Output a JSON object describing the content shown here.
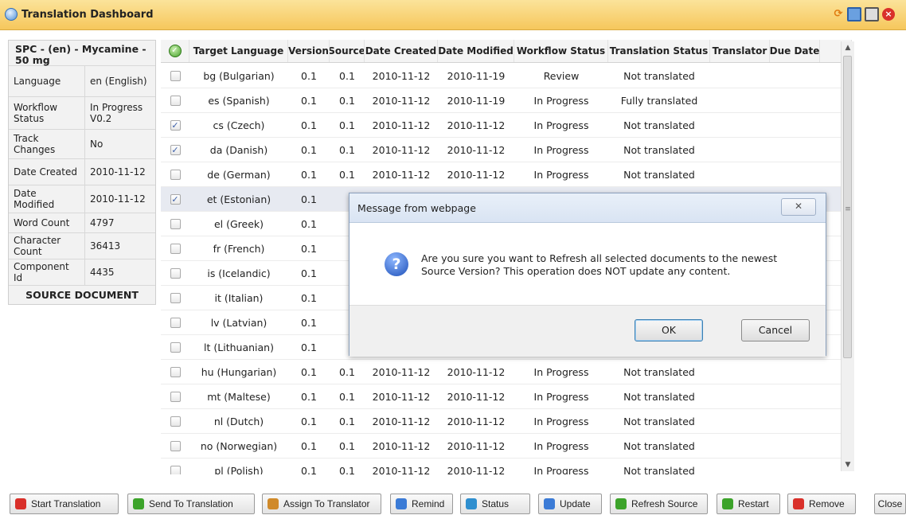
{
  "window": {
    "title": "Translation Dashboard"
  },
  "document": {
    "header": "SPC - (en) - Mycamine - 50 mg",
    "fields": [
      {
        "label": "Language",
        "value": "en (English)"
      },
      {
        "label": "Workflow Status",
        "value": "In Progress V0.2"
      },
      {
        "label": "Track Changes",
        "value": "No"
      },
      {
        "label": "Date Created",
        "value": "2010-11-12"
      },
      {
        "label": "Date Modified",
        "value": "2010-11-12"
      },
      {
        "label": "Word Count",
        "value": "4797"
      },
      {
        "label": "Character Count",
        "value": "36413"
      },
      {
        "label": "Component Id",
        "value": "4435"
      }
    ],
    "footer": "SOURCE DOCUMENT"
  },
  "grid": {
    "headers": [
      "Target Language",
      "Version",
      "Source",
      "Date Created",
      "Date Modified",
      "Workflow Status",
      "Translation Status",
      "Translator",
      "Due Date"
    ],
    "rows": [
      {
        "checked": false,
        "lang": "bg (Bulgarian)",
        "version": "0.1",
        "source": "0.1",
        "created": "2010-11-12",
        "modified": "2010-11-19",
        "workflow": "Review",
        "translation": "Not translated",
        "translator": "",
        "due": ""
      },
      {
        "checked": false,
        "lang": "es (Spanish)",
        "version": "0.1",
        "source": "0.1",
        "created": "2010-11-12",
        "modified": "2010-11-19",
        "workflow": "In Progress",
        "translation": "Fully translated",
        "translator": "",
        "due": ""
      },
      {
        "checked": true,
        "lang": "cs (Czech)",
        "version": "0.1",
        "source": "0.1",
        "created": "2010-11-12",
        "modified": "2010-11-12",
        "workflow": "In Progress",
        "translation": "Not translated",
        "translator": "",
        "due": ""
      },
      {
        "checked": true,
        "lang": "da (Danish)",
        "version": "0.1",
        "source": "0.1",
        "created": "2010-11-12",
        "modified": "2010-11-12",
        "workflow": "In Progress",
        "translation": "Not translated",
        "translator": "",
        "due": ""
      },
      {
        "checked": false,
        "lang": "de (German)",
        "version": "0.1",
        "source": "0.1",
        "created": "2010-11-12",
        "modified": "2010-11-12",
        "workflow": "In Progress",
        "translation": "Not translated",
        "translator": "",
        "due": ""
      },
      {
        "checked": true,
        "lang": "et (Estonian)",
        "version": "0.1",
        "source": "",
        "created": "",
        "modified": "",
        "workflow": "",
        "translation": "",
        "translator": "",
        "due": ""
      },
      {
        "checked": false,
        "lang": "el (Greek)",
        "version": "0.1",
        "source": "",
        "created": "",
        "modified": "",
        "workflow": "",
        "translation": "",
        "translator": "",
        "due": ""
      },
      {
        "checked": false,
        "lang": "fr (French)",
        "version": "0.1",
        "source": "",
        "created": "",
        "modified": "",
        "workflow": "",
        "translation": "",
        "translator": "",
        "due": ""
      },
      {
        "checked": false,
        "lang": "is (Icelandic)",
        "version": "0.1",
        "source": "",
        "created": "",
        "modified": "",
        "workflow": "",
        "translation": "",
        "translator": "",
        "due": ""
      },
      {
        "checked": false,
        "lang": "it (Italian)",
        "version": "0.1",
        "source": "",
        "created": "",
        "modified": "",
        "workflow": "",
        "translation": "",
        "translator": "",
        "due": ""
      },
      {
        "checked": false,
        "lang": "lv (Latvian)",
        "version": "0.1",
        "source": "",
        "created": "",
        "modified": "",
        "workflow": "",
        "translation": "",
        "translator": "",
        "due": ""
      },
      {
        "checked": false,
        "lang": "lt (Lithuanian)",
        "version": "0.1",
        "source": "",
        "created": "",
        "modified": "",
        "workflow": "",
        "translation": "",
        "translator": "",
        "due": ""
      },
      {
        "checked": false,
        "lang": "hu (Hungarian)",
        "version": "0.1",
        "source": "0.1",
        "created": "2010-11-12",
        "modified": "2010-11-12",
        "workflow": "In Progress",
        "translation": "Not translated",
        "translator": "",
        "due": ""
      },
      {
        "checked": false,
        "lang": "mt (Maltese)",
        "version": "0.1",
        "source": "0.1",
        "created": "2010-11-12",
        "modified": "2010-11-12",
        "workflow": "In Progress",
        "translation": "Not translated",
        "translator": "",
        "due": ""
      },
      {
        "checked": false,
        "lang": "nl (Dutch)",
        "version": "0.1",
        "source": "0.1",
        "created": "2010-11-12",
        "modified": "2010-11-12",
        "workflow": "In Progress",
        "translation": "Not translated",
        "translator": "",
        "due": ""
      },
      {
        "checked": false,
        "lang": "no (Norwegian)",
        "version": "0.1",
        "source": "0.1",
        "created": "2010-11-12",
        "modified": "2010-11-12",
        "workflow": "In Progress",
        "translation": "Not translated",
        "translator": "",
        "due": ""
      },
      {
        "checked": false,
        "lang": "pl (Polish)",
        "version": "0.1",
        "source": "0.1",
        "created": "2010-11-12",
        "modified": "2010-11-12",
        "workflow": "In Progress",
        "translation": "Not translated",
        "translator": "",
        "due": ""
      }
    ]
  },
  "dialog": {
    "title": "Message from webpage",
    "message": "Are you sure you want to Refresh all selected documents to the newest Source Version? This operation does NOT update any content.",
    "ok": "OK",
    "cancel": "Cancel",
    "close_glyph": "✕",
    "icon_glyph": "?"
  },
  "toolbar": {
    "buttons": [
      {
        "label": "Start Translation",
        "icon": "start-icon",
        "color": "#d9302a"
      },
      {
        "label": "Send To Translation",
        "icon": "send-icon",
        "color": "#3ca32a"
      },
      {
        "label": "Assign To Translator",
        "icon": "assign-icon",
        "color": "#d08a2a"
      },
      {
        "label": "Remind",
        "icon": "remind-icon",
        "color": "#3b7bd6"
      },
      {
        "label": "Status",
        "icon": "status-icon",
        "color": "#2f8fcf"
      },
      {
        "label": "Update",
        "icon": "update-icon",
        "color": "#3b7bd6"
      },
      {
        "label": "Refresh Source",
        "icon": "refresh-source-icon",
        "color": "#3ca32a"
      },
      {
        "label": "Restart",
        "icon": "restart-icon",
        "color": "#3ca32a"
      },
      {
        "label": "Remove",
        "icon": "remove-icon",
        "color": "#d9302a"
      },
      {
        "label": "Close",
        "icon": "",
        "color": ""
      }
    ]
  },
  "colors": {
    "title_bar": "#f6c75c",
    "selected_row": "#e7eaf1",
    "dialog_title": "#d9e4f3"
  }
}
